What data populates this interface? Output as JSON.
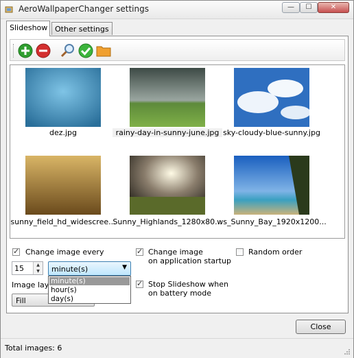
{
  "window": {
    "title": "AeroWallpaperChanger settings",
    "controls": {
      "minimize": "—",
      "maximize": "☐",
      "close": "✕"
    }
  },
  "tabs": [
    {
      "label": "Slideshow",
      "active": true
    },
    {
      "label": "Other settings",
      "active": false
    }
  ],
  "toolbar": {
    "buttons": [
      {
        "name": "add-icon"
      },
      {
        "name": "remove-icon"
      },
      {
        "name": "magnifier-icon"
      },
      {
        "name": "check-icon"
      },
      {
        "name": "folder-icon"
      }
    ]
  },
  "images": [
    {
      "file": "dez.jpg",
      "selected": false
    },
    {
      "file": "rainy-day-in-sunny-june.jpg",
      "selected": true
    },
    {
      "file": "sky-cloudy-blue-sunny.jpg",
      "selected": false
    },
    {
      "file": "sunny_field_hd_widescree...",
      "selected": false
    },
    {
      "file": "Sunny_Highlands_1280x80...",
      "selected": false
    },
    {
      "file": "ws_Sunny_Bay_1920x1200...",
      "selected": false
    }
  ],
  "options": {
    "change_every_label": "Change image every",
    "change_every_checked": true,
    "interval_value": "15",
    "interval_unit": "minute(s)",
    "unit_options": [
      "minute(s)",
      "hour(s)",
      "day(s)"
    ],
    "startup_label_1": "Change image",
    "startup_label_2": "on application startup",
    "startup_checked": true,
    "random_label": "Random order",
    "random_checked": false,
    "layout_label": "Image layo",
    "layout_value": "Fill",
    "battery_label_1": "Stop Slideshow when",
    "battery_label_2": "on battery mode",
    "battery_checked": true
  },
  "buttons": {
    "close": "Close"
  },
  "status": {
    "total_images": "Total images: 6"
  },
  "colors": {
    "accent": "#3c7fb1",
    "add_green": "#2f9e2f",
    "remove_red": "#d32f2f",
    "check_green": "#3cb43c",
    "folder_orange": "#f0a030"
  }
}
